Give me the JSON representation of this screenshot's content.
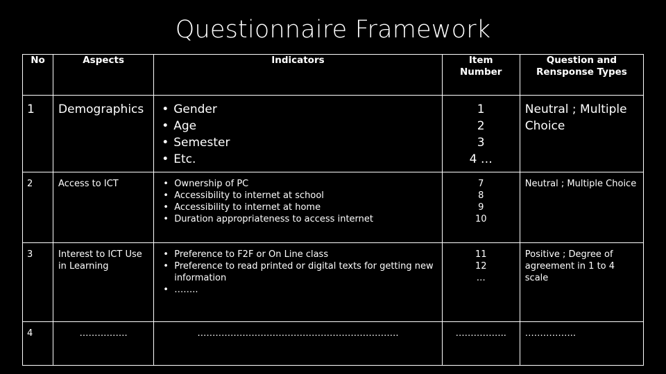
{
  "slide": {
    "title": "Questionnaire Framework",
    "background_color": "#000000",
    "text_color": "#FFFFFF",
    "border_color": "#FFFFFF"
  },
  "table": {
    "headers": {
      "no": "No",
      "aspects": "Aspects",
      "indicators": "Indicators",
      "item_number": "Item\nNumber",
      "item_number_line1": "Item",
      "item_number_line2": "Number",
      "question_types": "Question and\nRensponse Types",
      "question_types_line1": "Question and",
      "question_types_line2": "Rensponse Types"
    },
    "rows": [
      {
        "no": "1",
        "aspect": "Demographics",
        "indicators": [
          "Gender",
          "Age",
          "Semester",
          "Etc."
        ],
        "item_numbers": [
          "1",
          "2",
          "3",
          "4 …"
        ],
        "question_type": "Neutral ; Multiple Choice"
      },
      {
        "no": "2",
        "aspect": "Access to ICT",
        "indicators": [
          "Ownership of PC",
          "Accessibility to internet at school",
          "Accessibility to internet at home",
          "Duration appropriateness to access internet"
        ],
        "item_numbers": [
          "7",
          "8",
          "9",
          "10"
        ],
        "question_type": "Neutral ; Multiple Choice"
      },
      {
        "no": "3",
        "aspect": "Interest to ICT Use in Learning",
        "indicators": [
          "Preference to F2F or On Line class",
          "Preference to read printed or digital texts for getting new information",
          "…….."
        ],
        "item_numbers": [
          "11",
          "12",
          "…"
        ],
        "question_type": "Positive ; Degree of agreement in 1 to 4 scale"
      },
      {
        "no": "4",
        "aspect": "…………….",
        "indicators": "………………………………………………………….",
        "item_numbers": [
          "…………….."
        ],
        "question_type": "…………….."
      }
    ],
    "bullet_glyph": "•"
  }
}
